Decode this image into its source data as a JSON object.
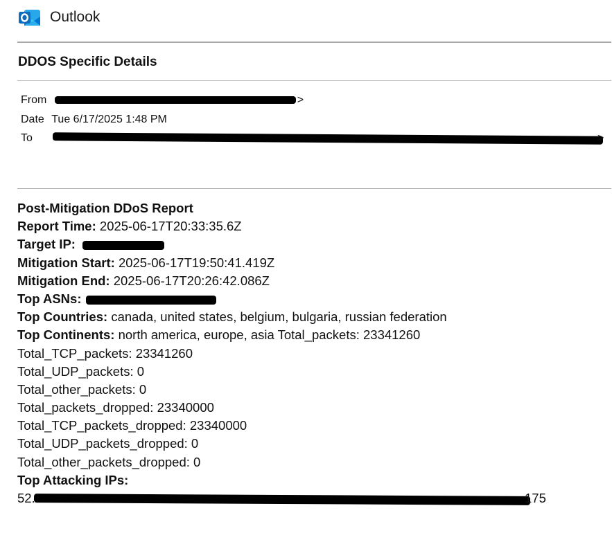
{
  "app": {
    "title": "Outlook"
  },
  "email": {
    "subject": "DDOS Specific Details",
    "from_label": "From",
    "from_suffix": ">",
    "date_label": "Date",
    "date_value": "Tue 6/17/2025 1:48 PM",
    "to_label": "To",
    "to_suffix": ">"
  },
  "report": {
    "title": "Post-Mitigation DDoS Report",
    "report_time_label": "Report Time:",
    "report_time_value": "2025-06-17T20:33:35.6Z",
    "target_ip_label": "Target IP:",
    "mitigation_start_label": "Mitigation Start:",
    "mitigation_start_value": "2025-06-17T19:50:41.419Z",
    "mitigation_end_label": "Mitigation End:",
    "mitigation_end_value": "2025-06-17T20:26:42.086Z",
    "top_asns_label": "Top ASNs:",
    "top_countries_label": "Top Countries:",
    "top_countries_value": "canada, united states, belgium, bulgaria, russian federation",
    "top_continents_label": "Top Continents:",
    "top_continents_value": "north america, europe, asia Total_packets: 23341260",
    "stats": [
      "Total_TCP_packets: 23341260",
      "Total_UDP_packets: 0",
      "Total_other_packets: 0",
      "Total_packets_dropped: 23340000",
      "Total_TCP_packets_dropped: 23340000",
      "Total_UDP_packets_dropped: 0",
      "Total_other_packets_dropped: 0"
    ],
    "top_attacking_ips_label": "Top Attacking IPs:",
    "top_attacking_ips_prefix": "52.",
    "top_attacking_ips_suffix": "175"
  },
  "icons": {
    "outlook": "outlook-logo-icon"
  },
  "colors": {
    "outlook_blue": "#0f6cbd",
    "outlook_dark_blue": "#0a4a8c",
    "divider": "#a7a7a7",
    "redaction": "#000000"
  }
}
